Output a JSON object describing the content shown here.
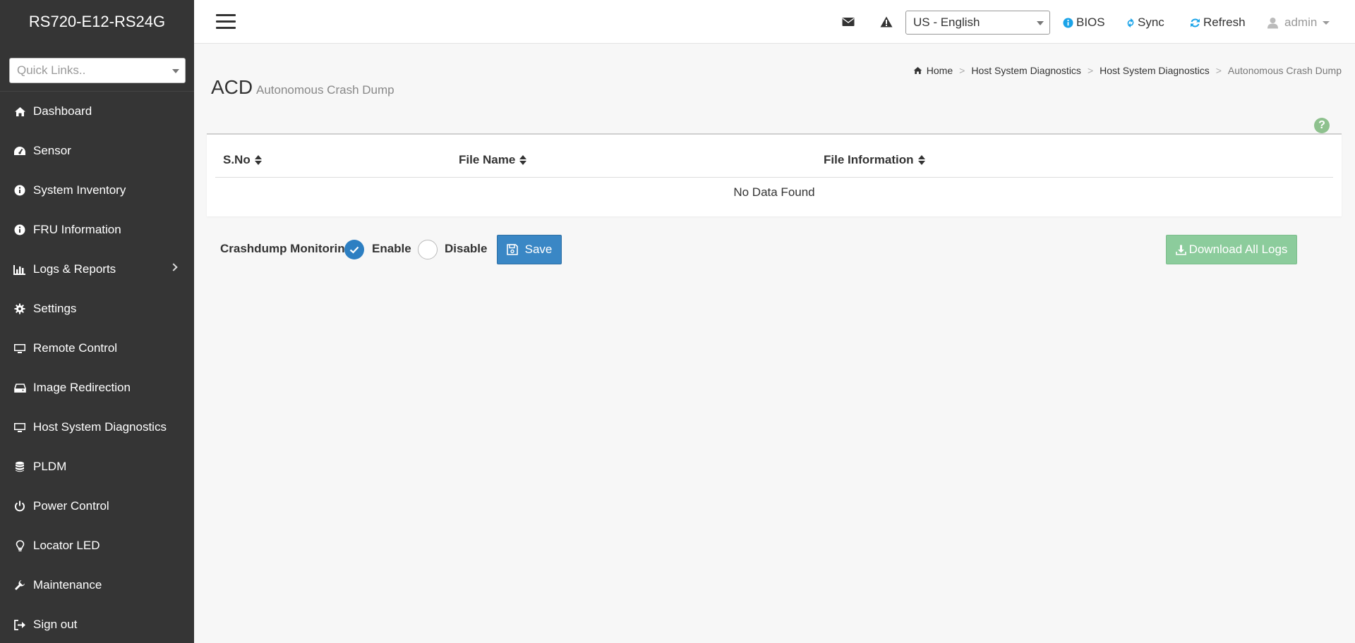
{
  "app": {
    "title": "RS720-E12-RS24G"
  },
  "sidebar": {
    "quick_links_placeholder": "Quick Links..",
    "items": [
      {
        "label": "Dashboard",
        "icon": "home-icon"
      },
      {
        "label": "Sensor",
        "icon": "tachometer-icon"
      },
      {
        "label": "System Inventory",
        "icon": "info-circle-icon"
      },
      {
        "label": "FRU Information",
        "icon": "info-circle-icon"
      },
      {
        "label": "Logs & Reports",
        "icon": "bar-chart-icon",
        "has_submenu": true
      },
      {
        "label": "Settings",
        "icon": "gear-icon"
      },
      {
        "label": "Remote Control",
        "icon": "monitor-icon"
      },
      {
        "label": "Image Redirection",
        "icon": "drive-icon"
      },
      {
        "label": "Host System Diagnostics",
        "icon": "monitor-icon"
      },
      {
        "label": "PLDM",
        "icon": "database-icon"
      },
      {
        "label": "Power Control",
        "icon": "power-icon"
      },
      {
        "label": "Locator LED",
        "icon": "lightbulb-icon"
      },
      {
        "label": "Maintenance",
        "icon": "wrench-icon"
      },
      {
        "label": "Sign out",
        "icon": "sign-out-icon"
      }
    ]
  },
  "topbar": {
    "language": "US - English",
    "bios_label": "BIOS",
    "sync_label": "Sync",
    "refresh_label": "Refresh",
    "user_label": "admin"
  },
  "page": {
    "title": "ACD",
    "subtitle": "Autonomous Crash Dump",
    "breadcrumb": [
      "Home",
      "Host System Diagnostics",
      "Host System Diagnostics",
      "Autonomous Crash Dump"
    ]
  },
  "table": {
    "columns": [
      "S.No",
      "File Name",
      "File Information"
    ],
    "empty_text": "No Data Found"
  },
  "monitoring": {
    "label": "Crashdump Monitoring",
    "enable_label": "Enable",
    "disable_label": "Disable",
    "selected": "Enable",
    "save_label": "Save",
    "download_label": "Download All Logs"
  },
  "colors": {
    "sidebar_bg": "#353535",
    "primary": "#3a87c5",
    "success_disabled": "#8ccc9c",
    "info_blue": "#1aa3e8",
    "help_green": "#8ec18e"
  }
}
